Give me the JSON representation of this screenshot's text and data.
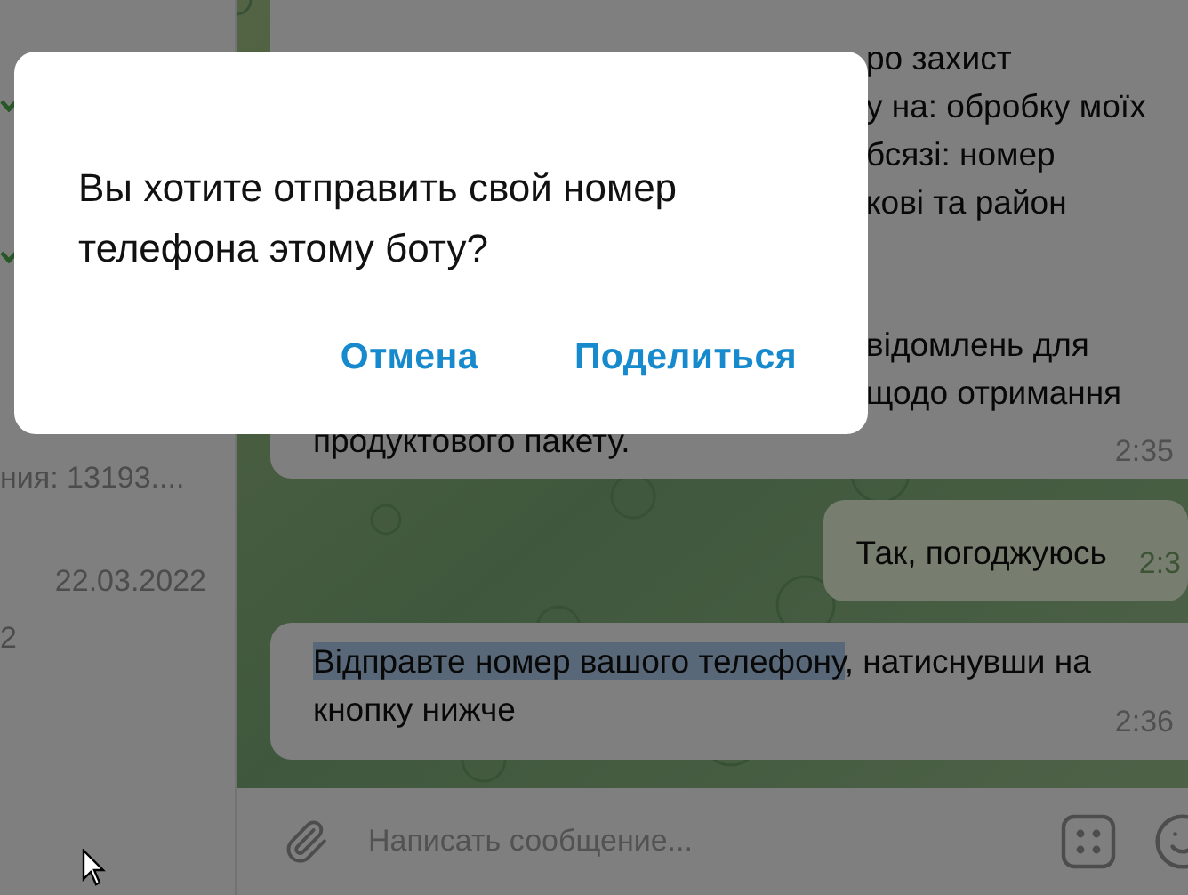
{
  "sidebar": {
    "items": [
      {
        "kind": "read_check"
      },
      {
        "kind": "read_check"
      },
      {
        "kind": "preview",
        "text": "ния: 13193...."
      },
      {
        "kind": "date",
        "text": "22.03.2022"
      },
      {
        "kind": "preview",
        "text": "2"
      }
    ]
  },
  "chat": {
    "messages": [
      {
        "kind": "incoming",
        "fragments": [
          [
            "ро захист",
            "у на: обробку моїх",
            "бсязі: номер",
            "кові та район"
          ],
          [
            "відомлень для",
            "щодо отримання"
          ]
        ],
        "last_line": "продуктового пакету.",
        "time": "2:35"
      },
      {
        "kind": "outgoing",
        "text": "Так, погоджуюсь",
        "time": "2:3"
      },
      {
        "kind": "incoming",
        "segments": [
          {
            "text": "Відправте номер вашого телефону",
            "selected": true
          },
          {
            "text": ", натиснувши на кнопку нижче",
            "selected": false
          }
        ],
        "time": "2:36"
      }
    ],
    "composer": {
      "placeholder": "Написать сообщение..."
    }
  },
  "dialog": {
    "message": "Вы хотите отправить свой номер телефона этому боту?",
    "buttons": [
      "Отмена",
      "Поделиться"
    ]
  }
}
